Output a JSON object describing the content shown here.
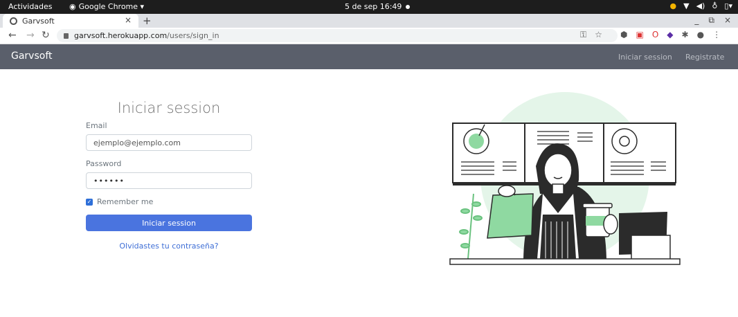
{
  "os_bar": {
    "activities": "Actividades",
    "app_name": "Google Chrome ▾",
    "clock": "5 de sep  16:49"
  },
  "browser": {
    "tab_title": "Garvsoft",
    "tab_close": "×",
    "new_tab": "+",
    "url_host": "garvsoft.herokuapp.com",
    "url_path": "/users/sign_in",
    "window_controls": [
      "_",
      "⧉",
      "×"
    ]
  },
  "navbar": {
    "brand": "Garvsoft",
    "links": [
      "Iniciar session",
      "Registrate"
    ]
  },
  "form": {
    "title": "Iniciar session",
    "email_label": "Email",
    "email_value": "ejemplo@ejemplo.com",
    "password_label": "Password",
    "password_value": "••••••",
    "remember_label": "Remember me",
    "remember_checked": true,
    "submit_label": "Iniciar session",
    "forgot_link": "Olvidastes tu contraseña?"
  },
  "colors": {
    "navbar": "#5a5f6b",
    "primary": "#4a74df",
    "illustration_green": "#8fd9a1"
  }
}
